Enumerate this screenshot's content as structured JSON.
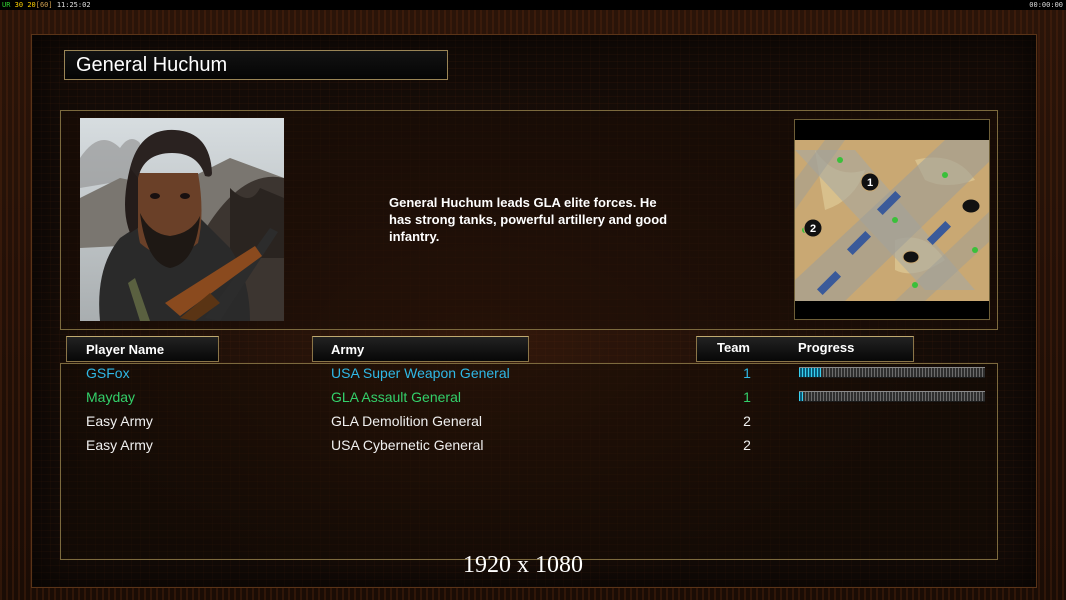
{
  "status_bar": {
    "ur": "UR",
    "fps": "30",
    "limit": "20",
    "cap": "[60]",
    "clock": "11:25:02",
    "timer": "00:00:00"
  },
  "general": {
    "title": "General Huchum",
    "description": "General Huchum leads GLA elite forces. He\n has strong tanks, powerful artillery and good\n infantry."
  },
  "columns": {
    "player": "Player Name",
    "army": "Army",
    "team": "Team",
    "progress": "Progress"
  },
  "players": [
    {
      "name": "GSFox",
      "army": "USA Super Weapon General",
      "team": "1",
      "color": "#2fb8e6",
      "progress": 0.12,
      "has_progress": true
    },
    {
      "name": "Mayday",
      "army": "GLA Assault General",
      "team": "1",
      "color": "#33d06a",
      "progress": 0.02,
      "has_progress": true
    },
    {
      "name": "Easy Army",
      "army": "GLA Demolition General",
      "team": "2",
      "color": "#f0f0f0",
      "has_progress": false
    },
    {
      "name": "Easy Army",
      "army": "USA Cybernetic General",
      "team": "2",
      "color": "#f0f0f0",
      "has_progress": false
    }
  ],
  "resolution": "1920 x 1080",
  "map_markers": [
    "1",
    "2"
  ]
}
